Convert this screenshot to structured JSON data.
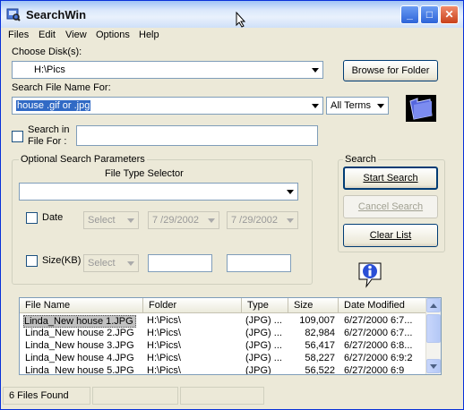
{
  "window": {
    "title": "SearchWin",
    "controls": {
      "minimize": "_",
      "maximize": "□",
      "close": "✕"
    }
  },
  "menu": [
    "Files",
    "Edit",
    "View",
    "Options",
    "Help"
  ],
  "choose_disk": {
    "label": "Choose Disk(s):",
    "value": "H:\\Pics",
    "browse_label": "Browse for Folder"
  },
  "search_name": {
    "label": "Search File Name For:",
    "value": "house .gif or .jpg",
    "terms_value": "All Terms"
  },
  "search_in_file": {
    "label_line1": "Search in",
    "label_line2": "File For :",
    "value": ""
  },
  "optional": {
    "group_title": "Optional Search Parameters",
    "file_type_label": "File Type Selector",
    "file_type_value": "",
    "date_label": "Date",
    "date_select": "Select",
    "date_from": "7 /29/2002",
    "date_to": "7 /29/2002",
    "size_label": "Size(KB)",
    "size_select": "Select",
    "size_from": "",
    "size_to": ""
  },
  "search_group": {
    "title": "Search",
    "start": "Start Search",
    "cancel": "Cancel Search",
    "clear": "Clear List"
  },
  "results": {
    "columns": [
      "File Name",
      "Folder",
      "Type",
      "Size",
      "Date Modified"
    ],
    "rows": [
      {
        "name": "Linda_New house 1.JPG",
        "folder": "H:\\Pics\\",
        "type": "(JPG) ...",
        "size": "109,007",
        "date": "6/27/2000 6:7..."
      },
      {
        "name": "Linda_New house 2.JPG",
        "folder": "H:\\Pics\\",
        "type": "(JPG) ...",
        "size": "82,984",
        "date": "6/27/2000 6:7..."
      },
      {
        "name": "Linda_New house 3.JPG",
        "folder": "H:\\Pics\\",
        "type": "(JPG) ...",
        "size": "56,417",
        "date": "6/27/2000 6:8..."
      },
      {
        "name": "Linda_New house 4.JPG",
        "folder": "H:\\Pics\\",
        "type": "(JPG) ...",
        "size": "58,227",
        "date": "6/27/2000 6:9:2"
      },
      {
        "name": "Linda_New house 5.JPG",
        "folder": "H:\\Pics\\",
        "type": "(JPG)",
        "size": "56,522",
        "date": "6/27/2000 6:9"
      }
    ]
  },
  "status": {
    "files_found": "6 Files Found",
    "panel2": "",
    "panel3": ""
  },
  "icons": {
    "app": "search-app-icon",
    "folder": "folder-icon",
    "info": "info-icon",
    "dropdown": "chevron-down-icon"
  },
  "colors": {
    "window_face": "#ece9d8",
    "title_gradient_top": "#9fc3f6",
    "selected_row": "#c0c0c0",
    "close_button": "#c9411b",
    "accent_blue": "#2d63d8"
  }
}
